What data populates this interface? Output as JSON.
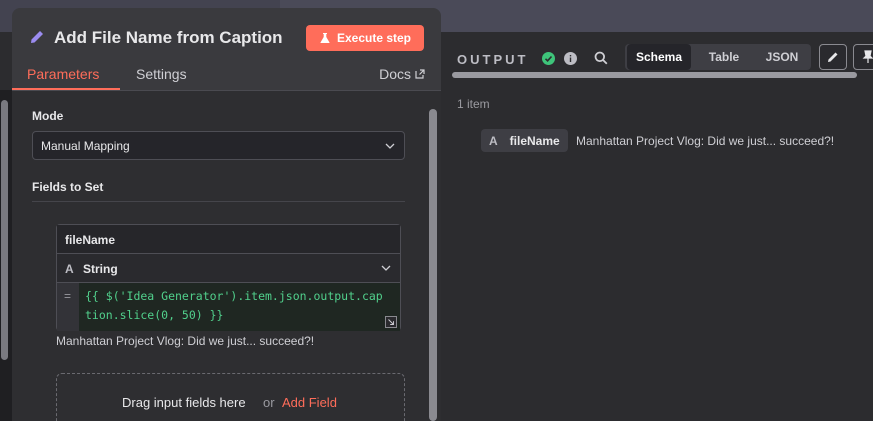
{
  "node": {
    "title": "Add File Name from Caption",
    "execute_label": "Execute step"
  },
  "tabs": [
    {
      "label": "Parameters",
      "active": true
    },
    {
      "label": "Settings",
      "active": false
    }
  ],
  "docs_label": "Docs",
  "mode": {
    "label": "Mode",
    "value": "Manual Mapping"
  },
  "fields_to_set": {
    "label": "Fields to Set",
    "field": {
      "name": "fileName",
      "type_icon": "A",
      "type": "String",
      "expr_marker": "=",
      "expression_line1": "{{ $('Idea Generator').item.json.output.cap",
      "expression_line2": "tion.slice(0, 50) }}",
      "preview": "Manhattan Project Vlog:  Did we just... succeed?!"
    },
    "drop_text": "Drag input fields here",
    "or_text": "or",
    "add_field_label": "Add Field"
  },
  "output": {
    "title": "OUTPUT",
    "views": [
      {
        "label": "Schema",
        "active": true
      },
      {
        "label": "Table",
        "active": false
      },
      {
        "label": "JSON",
        "active": false
      }
    ],
    "item_count": "1 item",
    "schema": {
      "type_icon": "A",
      "key": "fileName",
      "value": "Manhattan Project Vlog: Did we just... succeed?!"
    }
  },
  "colors": {
    "accent": "#ff6d5a",
    "success": "#3ec47a",
    "code": "#51d08c"
  }
}
